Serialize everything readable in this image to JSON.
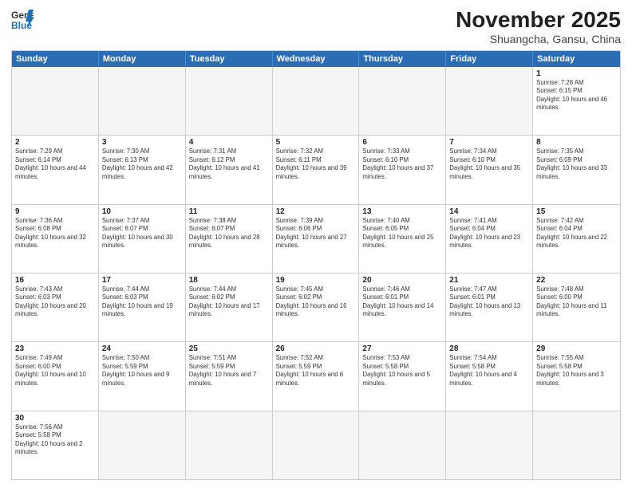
{
  "logo": {
    "line1": "General",
    "line2": "Blue"
  },
  "title": "November 2025",
  "subtitle": "Shuangcha, Gansu, China",
  "header_days": [
    "Sunday",
    "Monday",
    "Tuesday",
    "Wednesday",
    "Thursday",
    "Friday",
    "Saturday"
  ],
  "rows": [
    [
      {
        "day": "",
        "info": ""
      },
      {
        "day": "",
        "info": ""
      },
      {
        "day": "",
        "info": ""
      },
      {
        "day": "",
        "info": ""
      },
      {
        "day": "",
        "info": ""
      },
      {
        "day": "",
        "info": ""
      },
      {
        "day": "1",
        "info": "Sunrise: 7:28 AM\nSunset: 6:15 PM\nDaylight: 10 hours and 46 minutes."
      }
    ],
    [
      {
        "day": "2",
        "info": "Sunrise: 7:29 AM\nSunset: 6:14 PM\nDaylight: 10 hours and 44 minutes."
      },
      {
        "day": "3",
        "info": "Sunrise: 7:30 AM\nSunset: 6:13 PM\nDaylight: 10 hours and 42 minutes."
      },
      {
        "day": "4",
        "info": "Sunrise: 7:31 AM\nSunset: 6:12 PM\nDaylight: 10 hours and 41 minutes."
      },
      {
        "day": "5",
        "info": "Sunrise: 7:32 AM\nSunset: 6:11 PM\nDaylight: 10 hours and 39 minutes."
      },
      {
        "day": "6",
        "info": "Sunrise: 7:33 AM\nSunset: 6:10 PM\nDaylight: 10 hours and 37 minutes."
      },
      {
        "day": "7",
        "info": "Sunrise: 7:34 AM\nSunset: 6:10 PM\nDaylight: 10 hours and 35 minutes."
      },
      {
        "day": "8",
        "info": "Sunrise: 7:35 AM\nSunset: 6:09 PM\nDaylight: 10 hours and 33 minutes."
      }
    ],
    [
      {
        "day": "9",
        "info": "Sunrise: 7:36 AM\nSunset: 6:08 PM\nDaylight: 10 hours and 32 minutes."
      },
      {
        "day": "10",
        "info": "Sunrise: 7:37 AM\nSunset: 6:07 PM\nDaylight: 10 hours and 30 minutes."
      },
      {
        "day": "11",
        "info": "Sunrise: 7:38 AM\nSunset: 6:07 PM\nDaylight: 10 hours and 28 minutes."
      },
      {
        "day": "12",
        "info": "Sunrise: 7:39 AM\nSunset: 6:06 PM\nDaylight: 10 hours and 27 minutes."
      },
      {
        "day": "13",
        "info": "Sunrise: 7:40 AM\nSunset: 6:05 PM\nDaylight: 10 hours and 25 minutes."
      },
      {
        "day": "14",
        "info": "Sunrise: 7:41 AM\nSunset: 6:04 PM\nDaylight: 10 hours and 23 minutes."
      },
      {
        "day": "15",
        "info": "Sunrise: 7:42 AM\nSunset: 6:04 PM\nDaylight: 10 hours and 22 minutes."
      }
    ],
    [
      {
        "day": "16",
        "info": "Sunrise: 7:43 AM\nSunset: 6:03 PM\nDaylight: 10 hours and 20 minutes."
      },
      {
        "day": "17",
        "info": "Sunrise: 7:44 AM\nSunset: 6:03 PM\nDaylight: 10 hours and 19 minutes."
      },
      {
        "day": "18",
        "info": "Sunrise: 7:44 AM\nSunset: 6:02 PM\nDaylight: 10 hours and 17 minutes."
      },
      {
        "day": "19",
        "info": "Sunrise: 7:45 AM\nSunset: 6:02 PM\nDaylight: 10 hours and 16 minutes."
      },
      {
        "day": "20",
        "info": "Sunrise: 7:46 AM\nSunset: 6:01 PM\nDaylight: 10 hours and 14 minutes."
      },
      {
        "day": "21",
        "info": "Sunrise: 7:47 AM\nSunset: 6:01 PM\nDaylight: 10 hours and 13 minutes."
      },
      {
        "day": "22",
        "info": "Sunrise: 7:48 AM\nSunset: 6:00 PM\nDaylight: 10 hours and 11 minutes."
      }
    ],
    [
      {
        "day": "23",
        "info": "Sunrise: 7:49 AM\nSunset: 6:00 PM\nDaylight: 10 hours and 10 minutes."
      },
      {
        "day": "24",
        "info": "Sunrise: 7:50 AM\nSunset: 5:59 PM\nDaylight: 10 hours and 9 minutes."
      },
      {
        "day": "25",
        "info": "Sunrise: 7:51 AM\nSunset: 5:59 PM\nDaylight: 10 hours and 7 minutes."
      },
      {
        "day": "26",
        "info": "Sunrise: 7:52 AM\nSunset: 5:59 PM\nDaylight: 10 hours and 6 minutes."
      },
      {
        "day": "27",
        "info": "Sunrise: 7:53 AM\nSunset: 5:58 PM\nDaylight: 10 hours and 5 minutes."
      },
      {
        "day": "28",
        "info": "Sunrise: 7:54 AM\nSunset: 5:58 PM\nDaylight: 10 hours and 4 minutes."
      },
      {
        "day": "29",
        "info": "Sunrise: 7:55 AM\nSunset: 5:58 PM\nDaylight: 10 hours and 3 minutes."
      }
    ],
    [
      {
        "day": "30",
        "info": "Sunrise: 7:56 AM\nSunset: 5:58 PM\nDaylight: 10 hours and 2 minutes."
      },
      {
        "day": "",
        "info": ""
      },
      {
        "day": "",
        "info": ""
      },
      {
        "day": "",
        "info": ""
      },
      {
        "day": "",
        "info": ""
      },
      {
        "day": "",
        "info": ""
      },
      {
        "day": "",
        "info": ""
      }
    ]
  ]
}
